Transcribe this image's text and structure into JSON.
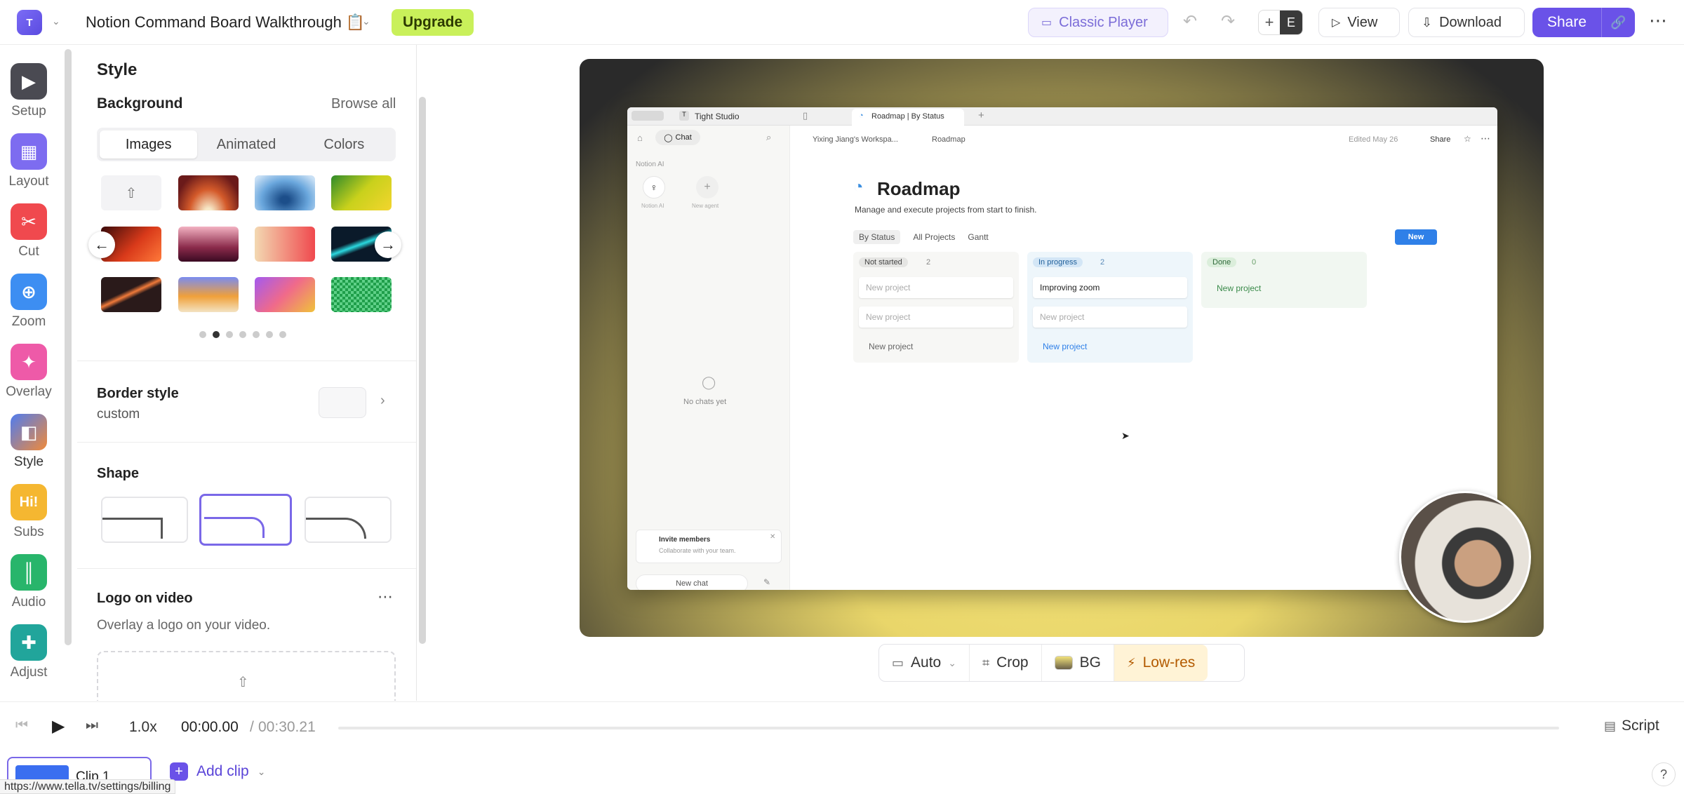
{
  "topbar": {
    "logo_text": "T",
    "project_title": "Notion Command Board Walkthrough 📋",
    "upgrade_label": "Upgrade",
    "classic_player_label": "Classic Player",
    "avatar_initial": "E",
    "view_label": "View",
    "download_label": "Download",
    "share_label": "Share"
  },
  "rail": {
    "items": [
      {
        "label": "Setup",
        "color": "#4a4a52"
      },
      {
        "label": "Layout",
        "color": "#7d6cf0"
      },
      {
        "label": "Cut",
        "color": "#f0494e"
      },
      {
        "label": "Zoom",
        "color": "#3d8ef2"
      },
      {
        "label": "Overlay",
        "color": "#ee5aa8"
      },
      {
        "label": "Style",
        "color": "#f08a3a"
      },
      {
        "label": "Subs",
        "color": "#f5b731"
      },
      {
        "label": "Audio",
        "color": "#28b56b"
      },
      {
        "label": "Adjust",
        "color": "#21a59b"
      }
    ]
  },
  "panel": {
    "title": "Style",
    "background_heading": "Background",
    "browse_all": "Browse all",
    "tabs": [
      "Images",
      "Animated",
      "Colors"
    ],
    "active_tab": "Images",
    "border_heading": "Border style",
    "border_value": "custom",
    "shape_heading": "Shape",
    "logo_heading": "Logo on video",
    "logo_sub": "Overlay a logo on your video."
  },
  "video": {
    "notion": {
      "workspace": "Tight Studio",
      "tab_title": "Roadmap | By Status",
      "chat_label": "Chat",
      "notion_ai_label": "Notion AI",
      "agent1": "Notion AI",
      "agent2": "New agent",
      "no_chats": "No chats yet",
      "invite_title": "Invite members",
      "invite_sub": "Collaborate with your team.",
      "new_chat": "New chat",
      "breadcrumb_1": "Yixing Jiang's Workspa...",
      "breadcrumb_2": "Roadmap",
      "edited": "Edited May 26",
      "share": "Share",
      "page_title": "Roadmap",
      "page_sub": "Manage and execute projects from start to finish.",
      "view_by_status": "By Status",
      "view_all": "All Projects",
      "view_gantt": "Gantt",
      "new_button": "New",
      "columns": [
        {
          "name": "Not started",
          "count": "2",
          "cards": [
            "New project",
            "New project"
          ],
          "add": "New project"
        },
        {
          "name": "In progress",
          "count": "2",
          "cards": [
            "Improving zoom",
            "New project"
          ],
          "add": "New project"
        },
        {
          "name": "Done",
          "count": "0",
          "cards": [],
          "add": "New project"
        }
      ]
    }
  },
  "toolbar2": {
    "auto": "Auto",
    "crop": "Crop",
    "bg": "BG",
    "lowres": "Low-res"
  },
  "timeline": {
    "speed": "1.0x",
    "current_time": "00:00.00",
    "separator": "/",
    "total_time": "00:30.21",
    "script_label": "Script",
    "clip_label": "Clip 1",
    "add_clip": "Add clip",
    "help": "?"
  },
  "status_url": "https://www.tella.tv/settings/billing",
  "colors": {
    "accent": "#6a52e8",
    "upgrade": "#c9f05a",
    "lowres": "#fff3d6"
  }
}
